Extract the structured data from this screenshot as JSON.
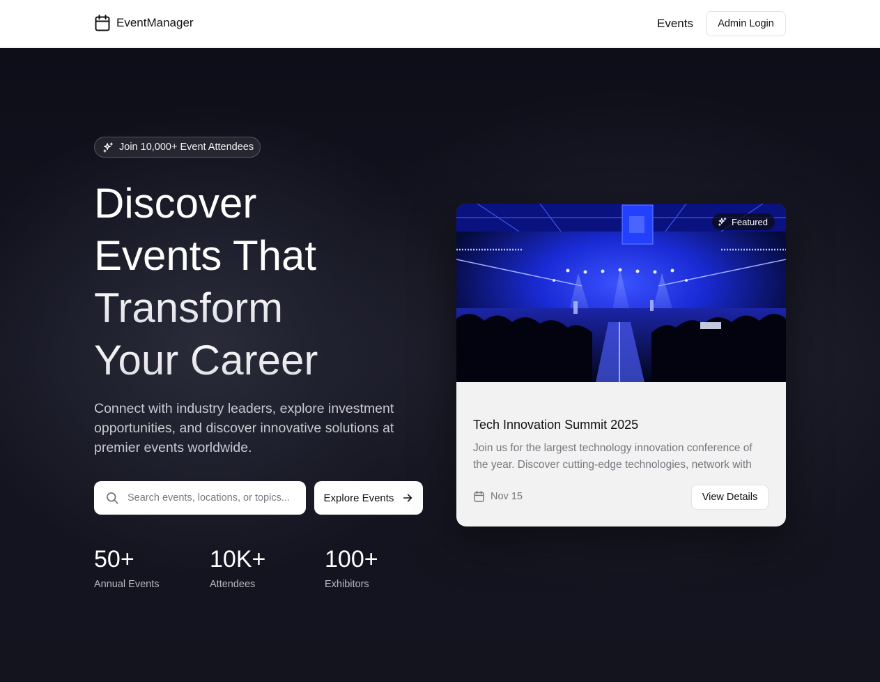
{
  "nav": {
    "brand_name": "EventManager",
    "events_link": "Events",
    "admin_login": "Admin Login"
  },
  "hero": {
    "pill_text": "Join 10,000+ Event Attendees",
    "headline_lines": [
      "Discover",
      "Events That",
      "Transform",
      "Your Career"
    ],
    "subtext": "Connect with industry leaders, explore investment opportunities, and discover innovative solutions at premier events worldwide.",
    "search_placeholder": "Search events, locations, or topics...",
    "search_value": "",
    "explore_label": "Explore Events",
    "stats": [
      {
        "value": "50+",
        "label": "Annual Events"
      },
      {
        "value": "10K+",
        "label": "Attendees"
      },
      {
        "value": "100+",
        "label": "Exhibitors"
      }
    ]
  },
  "featured": {
    "badge": "Featured",
    "title": "Tech Innovation Summit 2025",
    "description": "Join us for the largest technology innovation conference of the year. Discover cutting-edge technologies, network with",
    "date": "Nov 15",
    "details_label": "View Details"
  },
  "icons": {
    "brand": "calendar-icon",
    "pill": "sparkles-icon",
    "search": "search-icon",
    "explore": "arrow-right-icon",
    "badge": "sparkles-icon",
    "date": "calendar-icon"
  },
  "colors": {
    "hero_bg": "#12121d",
    "card_bg": "#f2f2f2",
    "stage_blue": "#1a2bd6"
  }
}
